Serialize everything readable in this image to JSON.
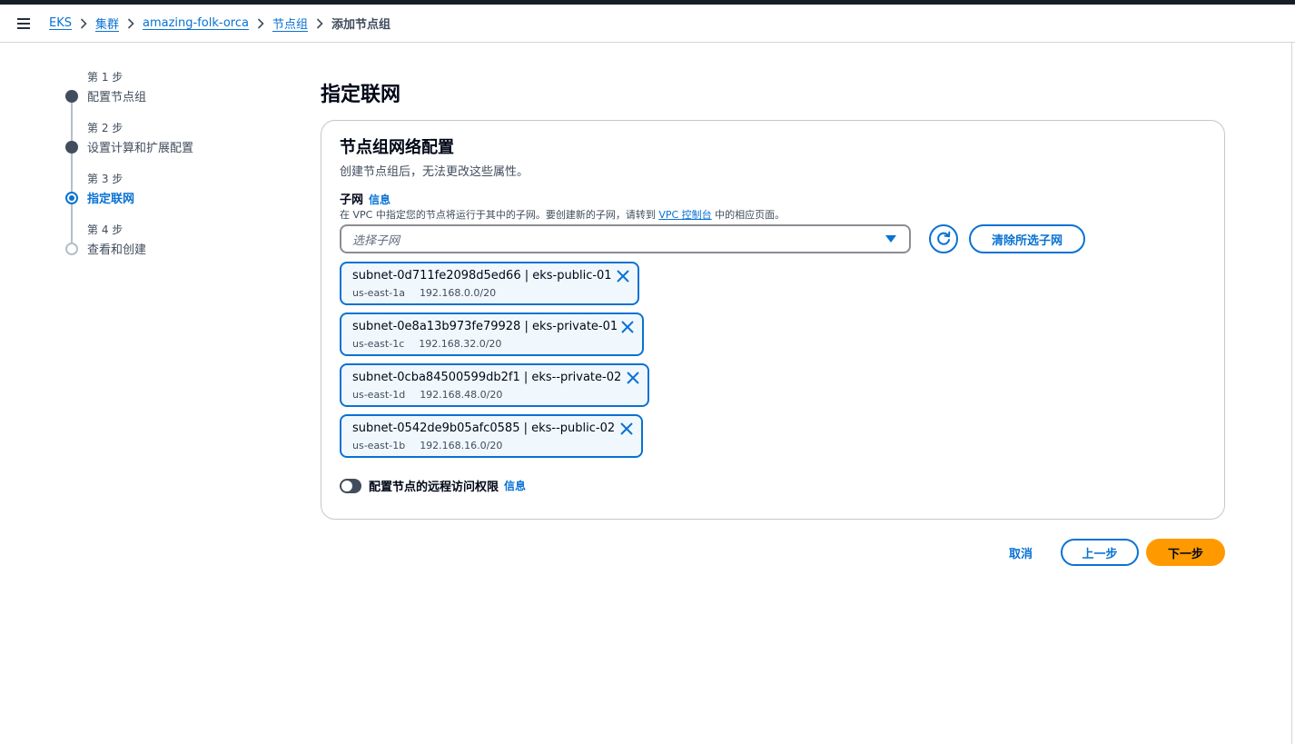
{
  "breadcrumb": {
    "items": [
      "EKS",
      "集群",
      "amazing-folk-orca",
      "节点组"
    ],
    "current": "添加节点组"
  },
  "steps": [
    {
      "num": "第 1 步",
      "title": "配置节点组",
      "state": "done"
    },
    {
      "num": "第 2 步",
      "title": "设置计算和扩展配置",
      "state": "done"
    },
    {
      "num": "第 3 步",
      "title": "指定联网",
      "state": "active"
    },
    {
      "num": "第 4 步",
      "title": "查看和创建",
      "state": "todo"
    }
  ],
  "main": {
    "title": "指定联网",
    "panel": {
      "title": "节点组网络配置",
      "description": "创建节点组后，无法更改这些属性。",
      "subnet": {
        "label": "子网",
        "info": "信息",
        "desc_before": "在 VPC 中指定您的节点将运行于其中的子网。要创建新的子网，请转到 ",
        "desc_link": "VPC 控制台",
        "desc_after": " 中的相应页面。",
        "placeholder": "选择子网",
        "clear_label": "清除所选子网",
        "tokens": [
          {
            "name": "subnet-0d711fe2098d5ed66 | eks-public-01",
            "zone": "us-east-1a",
            "cidr": "192.168.0.0/20"
          },
          {
            "name": "subnet-0e8a13b973fe79928 | eks-private-01",
            "zone": "us-east-1c",
            "cidr": "192.168.32.0/20"
          },
          {
            "name": "subnet-0cba84500599db2f1 | eks--private-02",
            "zone": "us-east-1d",
            "cidr": "192.168.48.0/20"
          },
          {
            "name": "subnet-0542de9b05afc0585 | eks--public-02",
            "zone": "us-east-1b",
            "cidr": "192.168.16.0/20"
          }
        ]
      },
      "remote_access": {
        "label": "配置节点的远程访问权限",
        "info": "信息",
        "enabled": false
      }
    }
  },
  "footer": {
    "cancel": "取消",
    "previous": "上一步",
    "next": "下一步"
  },
  "colors": {
    "accent": "#0972d3",
    "primary_button": "#ff9900",
    "token_bg": "#f0f8fe"
  }
}
